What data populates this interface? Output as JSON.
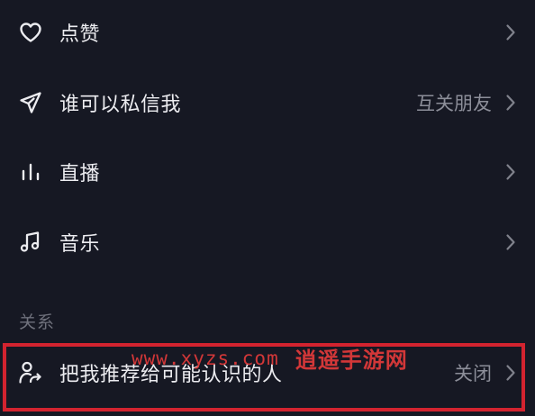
{
  "settings": {
    "items": [
      {
        "id": "like",
        "label": "点赞",
        "value": "",
        "icon": "heart-icon"
      },
      {
        "id": "dm",
        "label": "谁可以私信我",
        "value": "互关朋友",
        "icon": "send-icon"
      },
      {
        "id": "live",
        "label": "直播",
        "value": "",
        "icon": "equalizer-bars-icon"
      },
      {
        "id": "music",
        "label": "音乐",
        "value": "",
        "icon": "music-note-icon"
      }
    ]
  },
  "relations_section": {
    "header": "关系",
    "items": [
      {
        "id": "recommend",
        "label": "把我推荐给可能认识的人",
        "value": "关闭",
        "icon": "person-share-icon"
      }
    ]
  },
  "watermark": {
    "url": "www.xyzs.com",
    "name": "逍遥手游网"
  },
  "colors": {
    "background": "#161823",
    "text": "#ececf0",
    "secondary_text": "#8c8e99",
    "highlight": "#d3232f",
    "watermark": "#e23a3a"
  }
}
